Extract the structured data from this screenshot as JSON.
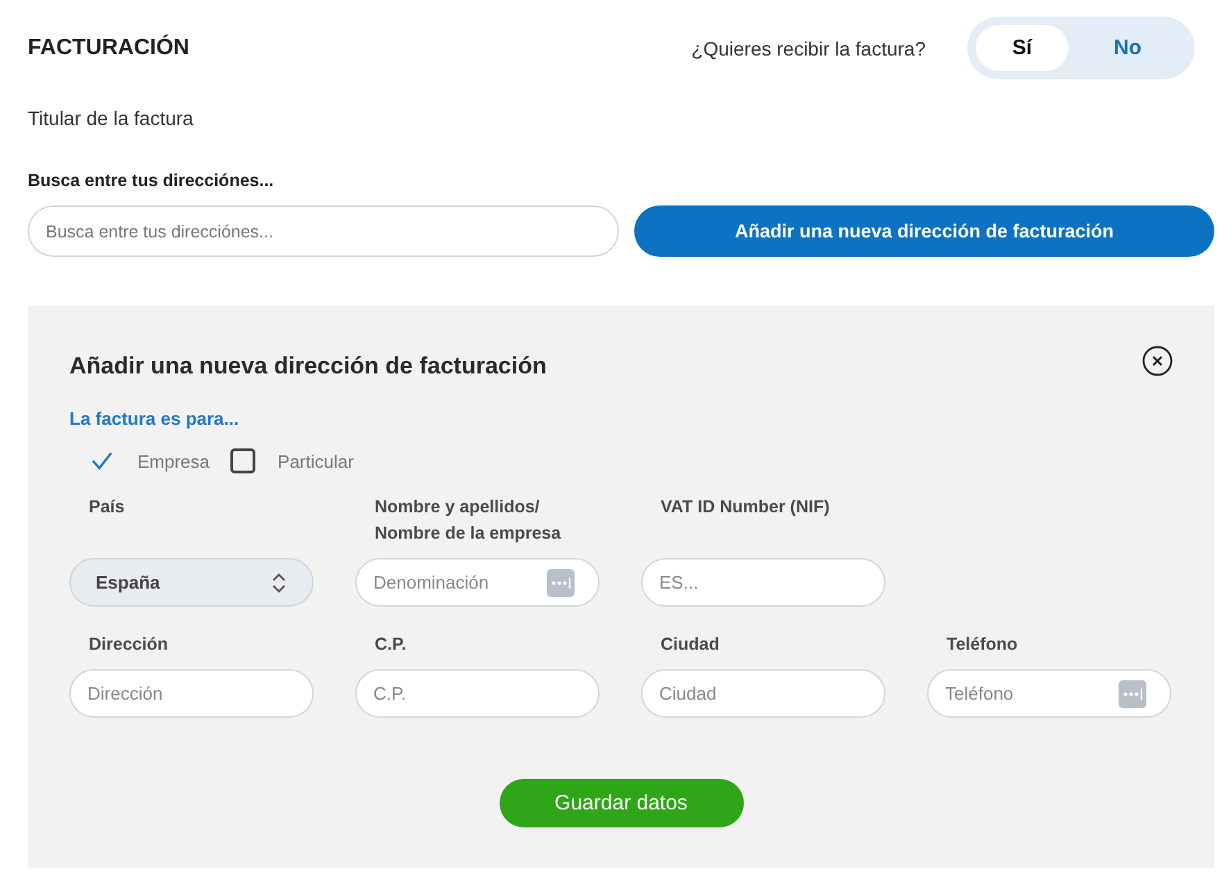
{
  "header": {
    "title": "FACTURACIÓN",
    "question": "¿Quieres recibir la factura?",
    "toggle": [
      {
        "label": "Sí",
        "selected": true
      },
      {
        "label": "No",
        "selected": false
      }
    ]
  },
  "holder_label": "Titular de la factura",
  "search": {
    "label": "Busca entre tus direcciónes...",
    "placeholder": "Busca entre tus direcciónes...",
    "button": "Añadir una nueva dirección de facturación"
  },
  "panel": {
    "title": "Añadir una nueva dirección de facturación",
    "subtitle": "La factura es para...",
    "options": [
      {
        "label": "Empresa",
        "checked": true
      },
      {
        "label": "Particular",
        "checked": false
      }
    ],
    "rows": [
      [
        {
          "label": "País",
          "kind": "select",
          "value": "España"
        },
        {
          "label": "Nombre y apellidos/ Nombre de la empresa",
          "kind": "input_dots",
          "placeholder": "Denominación"
        },
        {
          "label": "VAT ID Number (NIF)",
          "kind": "input",
          "placeholder": "ES..."
        }
      ],
      [
        {
          "label": "Dirección",
          "kind": "input",
          "placeholder": "Dirección"
        },
        {
          "label": "C.P.",
          "kind": "input",
          "placeholder": "C.P."
        },
        {
          "label": "Ciudad",
          "kind": "input",
          "placeholder": "Ciudad"
        },
        {
          "label": "Teléfono",
          "kind": "input_dots",
          "placeholder": "Teléfono"
        }
      ]
    ],
    "save_button": "Guardar datos"
  }
}
